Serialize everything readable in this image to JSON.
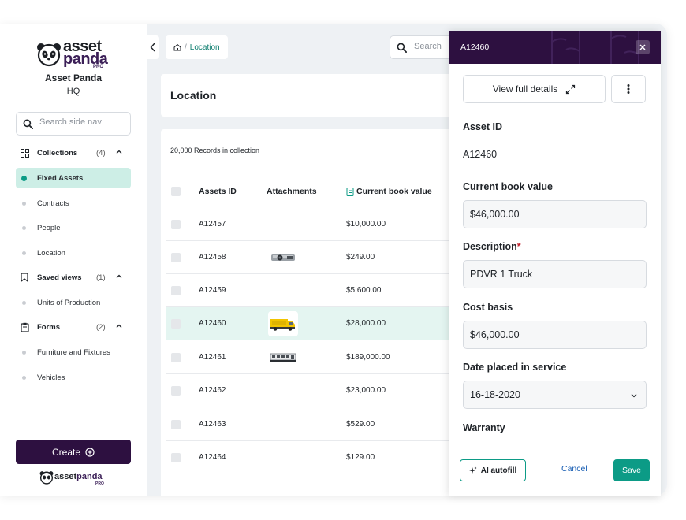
{
  "brand": {
    "logo_line1": "asset",
    "logo_line2": "panda",
    "logo_badge": "PRO",
    "bottom_logo_a": "asset",
    "bottom_logo_b": "panda",
    "bottom_logo_badge": "PRO",
    "accent": "#0c9b86",
    "primary": "#2d1040"
  },
  "sidebar": {
    "org_name": "Asset Panda",
    "org_location": "HQ",
    "search_placeholder": "Search side nav",
    "sections": [
      {
        "label": "Collections",
        "count": "(4)",
        "icon": "grid-icon",
        "items": [
          {
            "label": "Fixed Assets",
            "active": true
          },
          {
            "label": "Contracts"
          },
          {
            "label": "People"
          },
          {
            "label": "Location"
          }
        ]
      },
      {
        "label": "Saved views",
        "count": "(1)",
        "icon": "bookmark-icon",
        "items": [
          {
            "label": "Units of Production"
          }
        ]
      },
      {
        "label": "Forms",
        "count": "(2)",
        "icon": "clipboard-icon",
        "items": [
          {
            "label": "Furniture and Fixtures"
          },
          {
            "label": "Vehicles"
          }
        ]
      }
    ],
    "create_label": "Create"
  },
  "breadcrumb": {
    "separator": "/",
    "current": "Location"
  },
  "top_search_placeholder": "Search",
  "page_title": "Location",
  "table": {
    "record_count": "20,000 Records in collection",
    "columns": [
      "Assets ID",
      "Attachments",
      "Current book value"
    ],
    "rows": [
      {
        "id": "A12457",
        "value": "$10,000.00",
        "attachment": ""
      },
      {
        "id": "A12458",
        "value": "$249.00",
        "attachment": "projector"
      },
      {
        "id": "A12459",
        "value": "$5,600.00",
        "attachment": ""
      },
      {
        "id": "A12460",
        "value": "$28,000.00",
        "attachment": "truck",
        "selected": true
      },
      {
        "id": "A12461",
        "value": "$189,000.00",
        "attachment": "trailer"
      },
      {
        "id": "A12462",
        "value": "$23,000.00",
        "attachment": ""
      },
      {
        "id": "A12463",
        "value": "$529.00",
        "attachment": ""
      },
      {
        "id": "A12464",
        "value": "$129.00",
        "attachment": ""
      }
    ]
  },
  "panel": {
    "title": "A12460",
    "view_full_details": "View full details",
    "asset_id_label": "Asset ID",
    "asset_id_value": "A12460",
    "current_book_value_label": "Current book value",
    "current_book_value": "$46,000.00",
    "description_label": "Description",
    "description_required": "*",
    "description_value": "PDVR 1 Truck",
    "cost_basis_label": "Cost basis",
    "cost_basis_value": "$46,000.00",
    "date_label": "Date placed in service",
    "date_value": "16-18-2020",
    "warranty_label": "Warranty",
    "ai_autofill": "AI autofill",
    "cancel": "Cancel",
    "save": "Save"
  }
}
